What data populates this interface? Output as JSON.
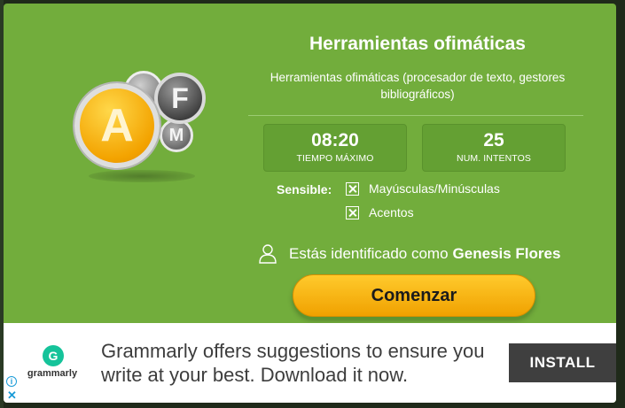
{
  "quiz": {
    "logo_letters": {
      "a": "A",
      "f": "F",
      "m": "M"
    },
    "title": "Herramientas ofimáticas",
    "description": "Herramientas ofimáticas (procesador de texto, gestores bibliográficos)",
    "stats": {
      "time_value": "08:20",
      "time_label": "TIEMPO MÁXIMO",
      "tries_value": "25",
      "tries_label": "NUM. INTENTOS"
    },
    "sensible": {
      "label": "Sensible:",
      "options": [
        "Mayúsculas/Minúsculas",
        "Acentos"
      ]
    },
    "identity": {
      "prefix": "Estás identificado como",
      "user_name": "Genesis Flores"
    },
    "start_label": "Comenzar"
  },
  "ad": {
    "brand": "grammarly",
    "brand_initial": "G",
    "text": "Grammarly offers suggestions to ensure you write at your best. Download it now.",
    "cta": "INSTALL",
    "info_glyph": "i",
    "close_glyph": "✕"
  },
  "colors": {
    "panel_green": "#72ad3c",
    "button_orange": "#f7b416",
    "ad_button": "#3f3f3f",
    "brand_green": "#15c39a"
  }
}
